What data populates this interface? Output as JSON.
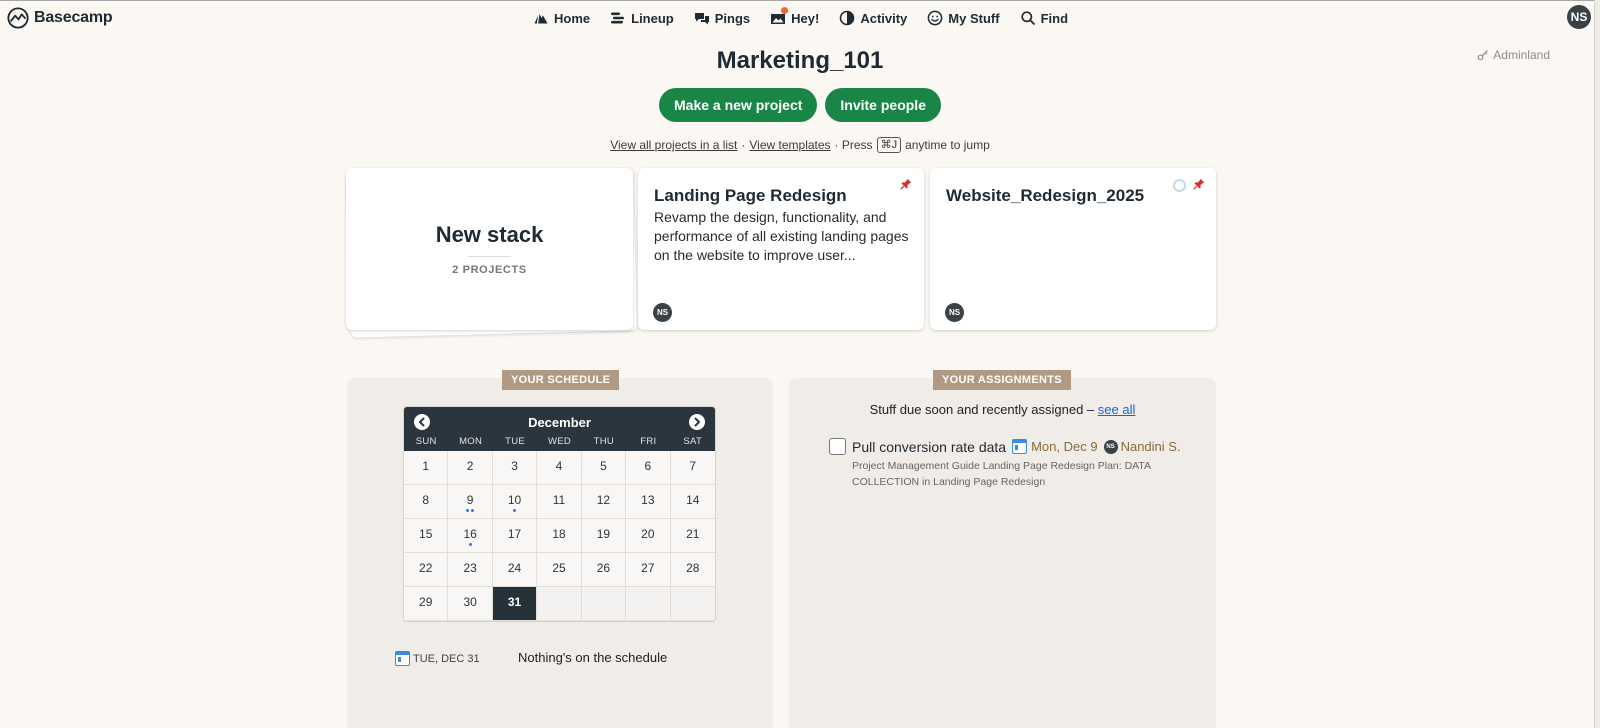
{
  "brand": {
    "name": "Basecamp"
  },
  "nav": [
    {
      "label": "Home",
      "icon": "home-icon"
    },
    {
      "label": "Lineup",
      "icon": "lineup-icon"
    },
    {
      "label": "Pings",
      "icon": "pings-icon"
    },
    {
      "label": "Hey!",
      "icon": "hey-icon"
    },
    {
      "label": "Activity",
      "icon": "activity-icon"
    },
    {
      "label": "My Stuff",
      "icon": "my-stuff-icon"
    },
    {
      "label": "Find",
      "icon": "search-icon"
    }
  ],
  "user": {
    "initials": "NS"
  },
  "adminland": {
    "label": "Adminland"
  },
  "page": {
    "title": "Marketing_101"
  },
  "actions": {
    "new_project": "Make a new project",
    "invite": "Invite people"
  },
  "links": {
    "all_projects": "View all projects in a list",
    "separator": "·",
    "templates": "View templates",
    "press": "· Press",
    "shortcut": "⌘J",
    "jump": "anytime to jump"
  },
  "stack": {
    "title": "New stack",
    "subtitle": "2 PROJECTS"
  },
  "projects": [
    {
      "title": "Landing Page Redesign",
      "description": "Revamp the design, functionality, and performance of all existing landing pages on the website to improve user...",
      "member": "NS"
    },
    {
      "title": "Website_Redesign_2025",
      "description": "",
      "member": "NS"
    }
  ],
  "schedule": {
    "tag": "YOUR SCHEDULE",
    "month": "December",
    "days_of_week": [
      "SUN",
      "MON",
      "TUE",
      "WED",
      "THU",
      "FRI",
      "SAT"
    ],
    "days": [
      [
        "1",
        "2",
        "3",
        "4",
        "5",
        "6",
        "7"
      ],
      [
        "8",
        "9",
        "10",
        "11",
        "12",
        "13",
        "14"
      ],
      [
        "15",
        "16",
        "17",
        "18",
        "19",
        "20",
        "21"
      ],
      [
        "22",
        "23",
        "24",
        "25",
        "26",
        "27",
        "28"
      ],
      [
        "29",
        "30",
        "31",
        "",
        "",
        "",
        ""
      ]
    ],
    "event_dots": {
      "9": 2,
      "10": 1,
      "16": 1
    },
    "today": "31",
    "selected_date": "TUE, DEC 31",
    "empty_message": "Nothing's on the schedule"
  },
  "assignments": {
    "tag": "YOUR ASSIGNMENTS",
    "intro": "Stuff due soon and recently assigned –",
    "see_all": "see all",
    "items": [
      {
        "title": "Pull conversion rate data",
        "due": "Mon, Dec 9",
        "assignee_initials": "NS",
        "assignee": "Nandini S.",
        "context": "Project Management Guide Landing Page Redesign Plan: DATA COLLECTION in Landing Page Redesign"
      }
    ]
  },
  "colors": {
    "accent_green": "#198648",
    "tag_tan": "#b09a83",
    "link_blue": "#1665d8",
    "pin_red": "#d0342c"
  }
}
